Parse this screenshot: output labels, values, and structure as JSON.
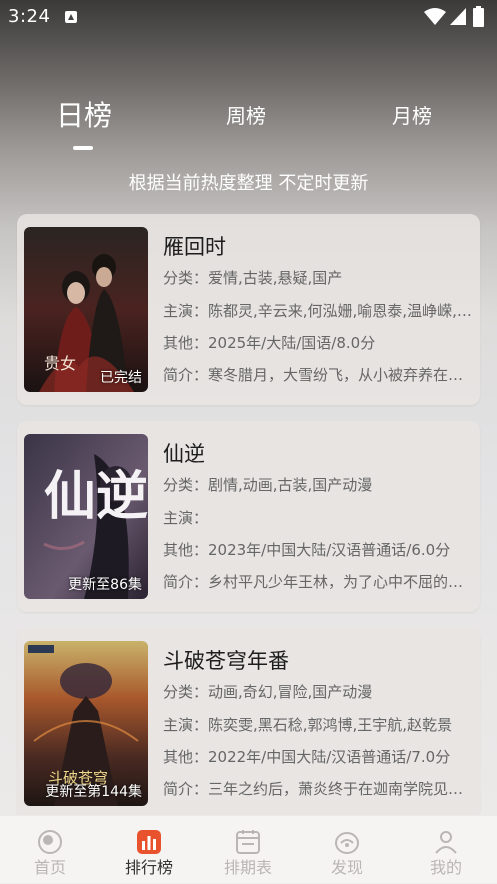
{
  "status": {
    "time": "3:24"
  },
  "tabs": [
    {
      "label": "日榜",
      "active": true
    },
    {
      "label": "周榜",
      "active": false
    },
    {
      "label": "月榜",
      "active": false
    }
  ],
  "subtitle": "根据当前热度整理 不定时更新",
  "items": [
    {
      "title": "雁回时",
      "badge": "已完结",
      "genre": "分类：爱情,古装,悬疑,国产",
      "cast": "主演：陈都灵,辛云来,何泓姗,喻恩泰,温峥嵘,刘奕铁",
      "other": "其他：2025年/大陆/国语/8.0分",
      "intro": "简介：寒冬腊月，大雪纷飞，从小被弃养在庄子上的庄寒雁",
      "poster_text": "贵女"
    },
    {
      "title": "仙逆",
      "badge": "更新至86集",
      "genre": "分类：剧情,动画,古装,国产动漫",
      "cast": "主演：",
      "other": "其他：2023年/中国大陆/汉语普通话/6.0分",
      "intro": "简介：乡村平凡少年王林，为了心中不屈的执念",
      "poster_text": "仙逆"
    },
    {
      "title": "斗破苍穹年番",
      "badge": "更新至第144集",
      "genre": "分类：动画,奇幻,冒险,国产动漫",
      "cast": "主演：陈奕雯,黑石稔,郭鸿博,王宇航,赵乾景",
      "other": "其他：2022年/中国大陆/汉语普通话/7.0分",
      "intro": "简介：三年之约后，萧炎终于在迦南学院见到了薰儿",
      "poster_text": "斗破苍穹"
    }
  ],
  "nav": [
    {
      "label": "首页",
      "icon": "home-icon",
      "active": false
    },
    {
      "label": "排行榜",
      "icon": "ranking-icon",
      "active": true
    },
    {
      "label": "排期表",
      "icon": "schedule-icon",
      "active": false
    },
    {
      "label": "发现",
      "icon": "discover-icon",
      "active": false
    },
    {
      "label": "我的",
      "icon": "profile-icon",
      "active": false
    }
  ],
  "colors": {
    "accent": "#e8522c",
    "nav_inactive": "#b9b6b4",
    "nav_active": "#333333"
  }
}
